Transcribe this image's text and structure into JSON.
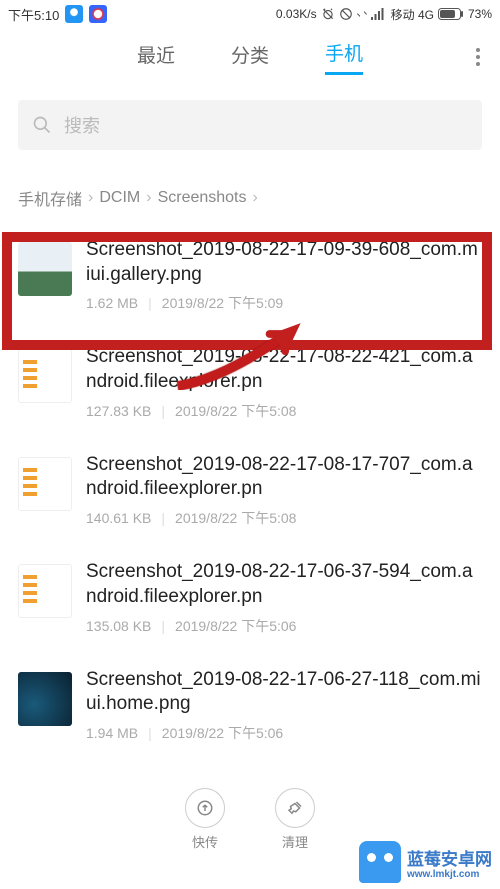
{
  "status": {
    "time": "下午5:10",
    "speed": "0.03K/s",
    "carrier": "移动 4G",
    "battery": "73%"
  },
  "tabs": {
    "recent": "最近",
    "category": "分类",
    "phone": "手机"
  },
  "search": {
    "placeholder": "搜索"
  },
  "breadcrumb": {
    "root": "手机存储",
    "d1": "DCIM",
    "d2": "Screenshots"
  },
  "files": [
    {
      "name": "Screenshot_2019-08-22-17-09-39-608_com.miui.gallery.png",
      "size": "1.62 MB",
      "date": "2019/8/22 下午5:09",
      "thumb": "gallery"
    },
    {
      "name": "Screenshot_2019-08-22-17-08-22-421_com.android.fileexplorer.pn",
      "size": "127.83 KB",
      "date": "2019/8/22 下午5:08",
      "thumb": "file-exp"
    },
    {
      "name": "Screenshot_2019-08-22-17-08-17-707_com.android.fileexplorer.pn",
      "size": "140.61 KB",
      "date": "2019/8/22 下午5:08",
      "thumb": "file-exp"
    },
    {
      "name": "Screenshot_2019-08-22-17-06-37-594_com.android.fileexplorer.pn",
      "size": "135.08 KB",
      "date": "2019/8/22 下午5:06",
      "thumb": "file-exp"
    },
    {
      "name": "Screenshot_2019-08-22-17-06-27-118_com.miui.home.png",
      "size": "1.94 MB",
      "date": "2019/8/22 下午5:06",
      "thumb": "home"
    }
  ],
  "bottom": {
    "send": "快传",
    "clean": "清理"
  },
  "watermark": {
    "title": "蓝莓安卓网",
    "url": "www.lmkjt.com"
  }
}
